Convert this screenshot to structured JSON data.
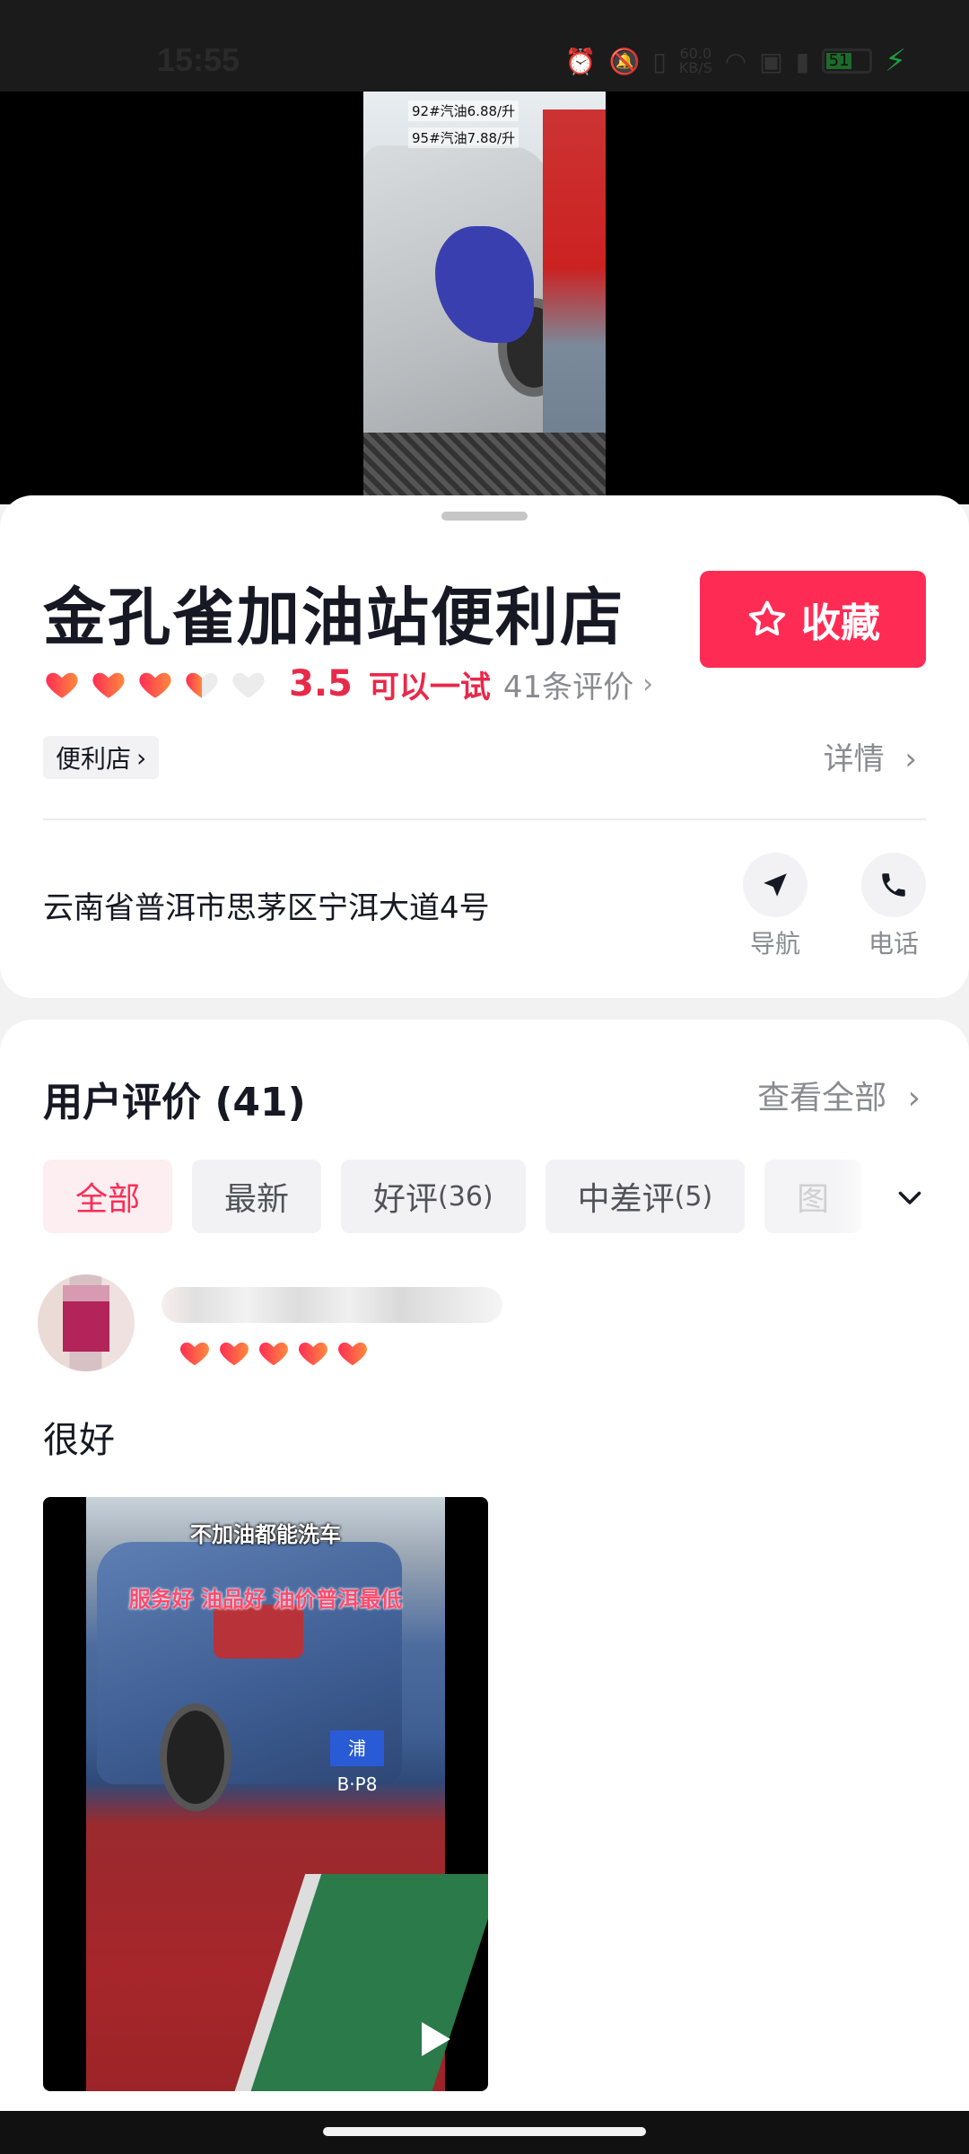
{
  "status_bar": {
    "time": "15:55",
    "net_speed": "60.0",
    "net_unit": "KB/S",
    "battery": "51"
  },
  "video": {
    "overlay_1": "92#汽油6.88/升",
    "overlay_2": "95#汽油7.88/升"
  },
  "shop": {
    "name": "金孔雀加油站便利店",
    "favorite_label": "收藏",
    "rating_hearts": 3.5,
    "score": "3.5",
    "rating_tag": "可以一试",
    "review_count_text": "41条评价",
    "category": "便利店",
    "detail_label": "详情",
    "address": "云南省普洱市思茅区宁洱大道4号",
    "actions": [
      {
        "label": "导航",
        "icon": "navigation-icon"
      },
      {
        "label": "电话",
        "icon": "phone-icon"
      }
    ]
  },
  "reviews": {
    "title": "用户评价 (41)",
    "see_all": "查看全部",
    "filters": [
      {
        "label": "全部",
        "count": "",
        "active": true
      },
      {
        "label": "最新",
        "count": "",
        "active": false
      },
      {
        "label": "好评",
        "count": "(36)",
        "active": false
      },
      {
        "label": "中差评",
        "count": "(5)",
        "active": false
      },
      {
        "label": "图",
        "count": "",
        "active": false
      }
    ],
    "items": [
      {
        "stars": 5,
        "text": "很好",
        "media_caption_1": "不加油都能洗车",
        "media_caption_2": "服务好 油品好 油价普洱最低",
        "plate": "浦B·P8"
      }
    ]
  },
  "colors": {
    "accent": "#fe2c55",
    "rating": "#e8294a"
  }
}
